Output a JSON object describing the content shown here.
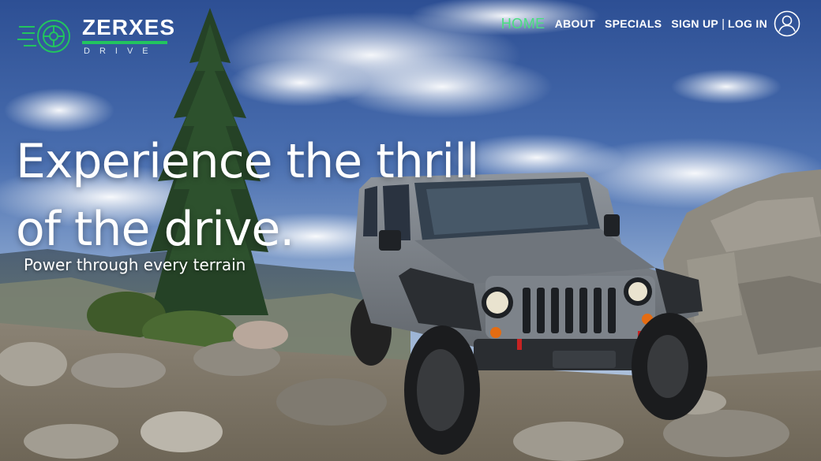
{
  "brand": {
    "name": "ZERXES",
    "sub": "DRIVE",
    "accent": "#22c55e",
    "icon": "wheel-icon"
  },
  "nav": {
    "items": [
      {
        "label": "HOME",
        "active": true
      },
      {
        "label": "ABOUT",
        "active": false
      },
      {
        "label": "SPECIALS",
        "active": false
      }
    ],
    "signup": "SIGN UP",
    "separator": "|",
    "login": "LOG IN",
    "user_icon": "user-circle-icon",
    "active_color": "#4ade80"
  },
  "hero": {
    "headline_line1": "Experience the thrill",
    "headline_line2": "of the drive.",
    "tagline": "Power through every  terrain"
  }
}
